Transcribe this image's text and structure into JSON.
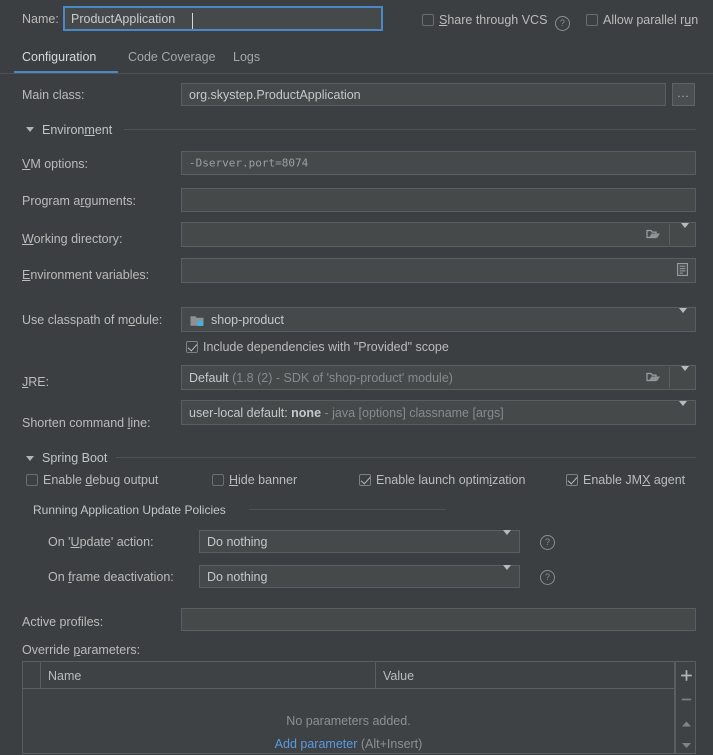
{
  "window": {
    "name_label": "Name:",
    "name_value": "ProductApplication",
    "share_vcs_label": "Share through VCS",
    "share_vcs_checked": false,
    "allow_parallel_label": "Allow parallel run",
    "allow_parallel_checked": false,
    "help_icon": "help-circle-icon"
  },
  "tabs": [
    {
      "label": "Configuration",
      "active": true
    },
    {
      "label": "Code Coverage",
      "active": false
    },
    {
      "label": "Logs",
      "active": false
    }
  ],
  "main_class": {
    "label": "Main class:",
    "value": "org.skystep.ProductApplication",
    "browse_button": "..."
  },
  "environment": {
    "section_title": "Environment",
    "vm_options": {
      "label": "VM options:",
      "value": "-Dserver.port=8074",
      "macro_icon": "plus-icon",
      "expand_icon": "expand-icon"
    },
    "program_arguments": {
      "label": "Program arguments:",
      "value": "",
      "expand_icon": "expand-icon"
    },
    "working_directory": {
      "label": "Working directory:",
      "value": "",
      "browse_icon": "folder-icon",
      "dropdown_icon": "chevron-down-icon"
    },
    "environment_variables": {
      "label": "Environment variables:",
      "value": "",
      "browse_icon": "list-icon"
    },
    "use_classpath": {
      "label": "Use classpath of module:",
      "value": "shop-product",
      "module_icon": "module-icon",
      "dropdown_icon": "chevron-down-icon"
    },
    "include_provided": {
      "label": "Include dependencies with \"Provided\" scope",
      "checked": true
    },
    "jre": {
      "label": "JRE:",
      "value": "Default",
      "hint": "(1.8 (2) - SDK of 'shop-product' module)",
      "browse_icon": "folder-icon",
      "dropdown_icon": "chevron-down-icon"
    },
    "shorten_command_line": {
      "label": "Shorten command line:",
      "value_prefix": "user-local default:",
      "value_bold": "none",
      "hint": "- java [options] classname [args]",
      "dropdown_icon": "chevron-down-icon"
    }
  },
  "spring_boot": {
    "section_title": "Spring Boot",
    "checkboxes": [
      {
        "label": "Enable debug output",
        "checked": false
      },
      {
        "label": "Hide banner",
        "checked": false
      },
      {
        "label": "Enable launch optimization",
        "checked": true
      },
      {
        "label": "Enable JMX agent",
        "checked": true
      }
    ],
    "update_policies": {
      "group_title": "Running Application Update Policies",
      "on_update": {
        "label": "On 'Update' action:",
        "value": "Do nothing",
        "dropdown_icon": "chevron-down-icon",
        "help_icon": "help-circle-icon"
      },
      "on_frame_deactivation": {
        "label": "On frame deactivation:",
        "value": "Do nothing",
        "dropdown_icon": "chevron-down-icon",
        "help_icon": "help-circle-icon"
      }
    },
    "active_profiles": {
      "label": "Active profiles:",
      "value": ""
    },
    "override_parameters": {
      "label": "Override parameters:",
      "columns": [
        "Name",
        "Value"
      ],
      "rows": [],
      "empty_text": "No parameters added.",
      "add_link": "Add parameter",
      "add_hint": "(Alt+Insert)",
      "toolbar": {
        "add": "plus-icon",
        "remove": "minus-icon",
        "move_up": "triangle-up-icon",
        "move_down": "triangle-down-icon"
      }
    }
  },
  "colors": {
    "background": "#3c3f41",
    "field_background": "#45494a",
    "accent_blue": "#4a88c7",
    "link_blue": "#5a9ae0",
    "text": "#bbbbbb",
    "text_dim": "#868b8e",
    "module_badge": "#3fb3e0"
  }
}
